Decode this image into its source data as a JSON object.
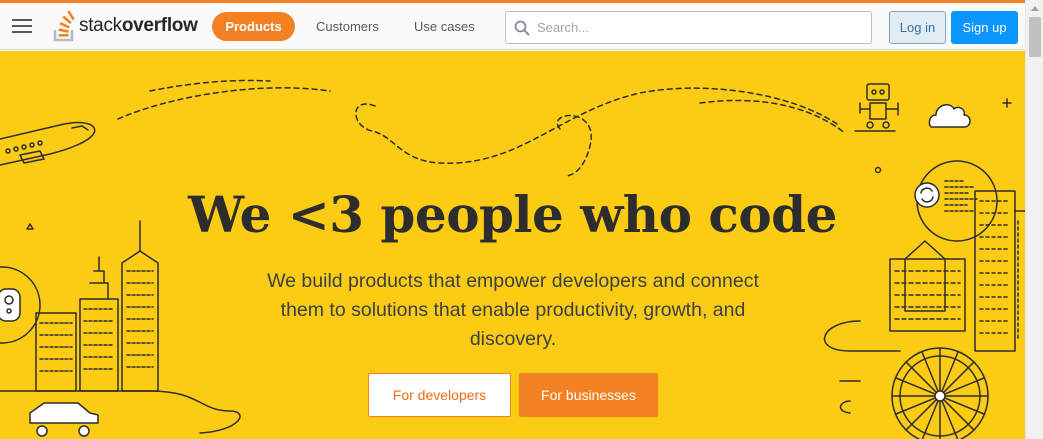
{
  "colors": {
    "accent": "#f48024",
    "hero_background": "#fccc14",
    "signup_blue": "#0a95ff",
    "login_bg": "#e1ecf4",
    "ink": "#2d2d2d"
  },
  "header": {
    "menu_icon": "hamburger-menu-icon",
    "logo": {
      "icon": "stackoverflow-logo-icon",
      "text_light": "stack",
      "text_bold": "overflow"
    },
    "nav": {
      "products": "Products",
      "customers": "Customers",
      "use_cases": "Use cases"
    },
    "search": {
      "icon": "search-icon",
      "placeholder": "Search...",
      "value": ""
    },
    "login_label": "Log in",
    "signup_label": "Sign up"
  },
  "hero": {
    "title": "We <3 people who code",
    "subtitle": "We build products that empower developers and connect them to solutions that enable productivity, growth, and discovery.",
    "for_developers_label": "For developers",
    "for_businesses_label": "For businesses",
    "illustrations": [
      "airplane-illustration",
      "robot-illustration",
      "cloud-illustration",
      "city-skyline-illustration",
      "gamepad-illustration",
      "car-illustration",
      "sync-icon",
      "building-illustration",
      "ferris-wheel-illustration"
    ]
  }
}
